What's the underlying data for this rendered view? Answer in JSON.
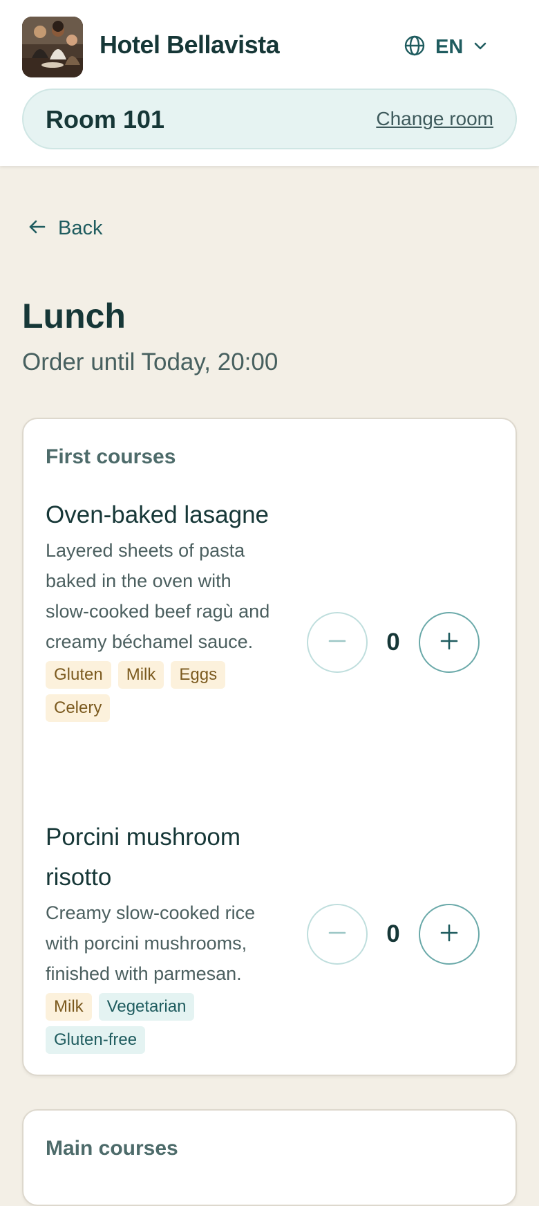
{
  "header": {
    "hotel_name": "Hotel Bellavista",
    "language": "EN",
    "room": "Room 101",
    "change_room": "Change room"
  },
  "nav": {
    "back": "Back"
  },
  "page": {
    "title": "Lunch",
    "subtitle": "Order until Today, 20:00"
  },
  "sections": [
    {
      "title": "First courses",
      "dishes": [
        {
          "name": "Oven-baked lasagne",
          "description": "Layered sheets of pasta baked in the oven with slow-cooked beef ragù and creamy béchamel sauce.",
          "tags": [
            "Gluten",
            "Milk",
            "Eggs",
            "Celery"
          ],
          "quantity": "0"
        },
        {
          "name": "Porcini mushroom risotto",
          "description": "Creamy slow-cooked rice with porcini mushrooms, finished with parmesan.",
          "tags": [
            "Milk",
            "Vegetarian",
            "Gluten-free"
          ],
          "quantity": "0"
        }
      ]
    },
    {
      "title": "Main courses"
    }
  ],
  "colors": {
    "accent": "#1f5c5f",
    "background": "#f3efe6",
    "allergen_tag_bg": "#fcf1dc",
    "diet_tag_bg": "#e4f3f2"
  },
  "icons": {
    "language": "globe-icon",
    "language_dropdown": "chevron-down-icon",
    "back": "arrow-left-icon",
    "decrease": "minus-icon",
    "increase": "plus-icon"
  }
}
